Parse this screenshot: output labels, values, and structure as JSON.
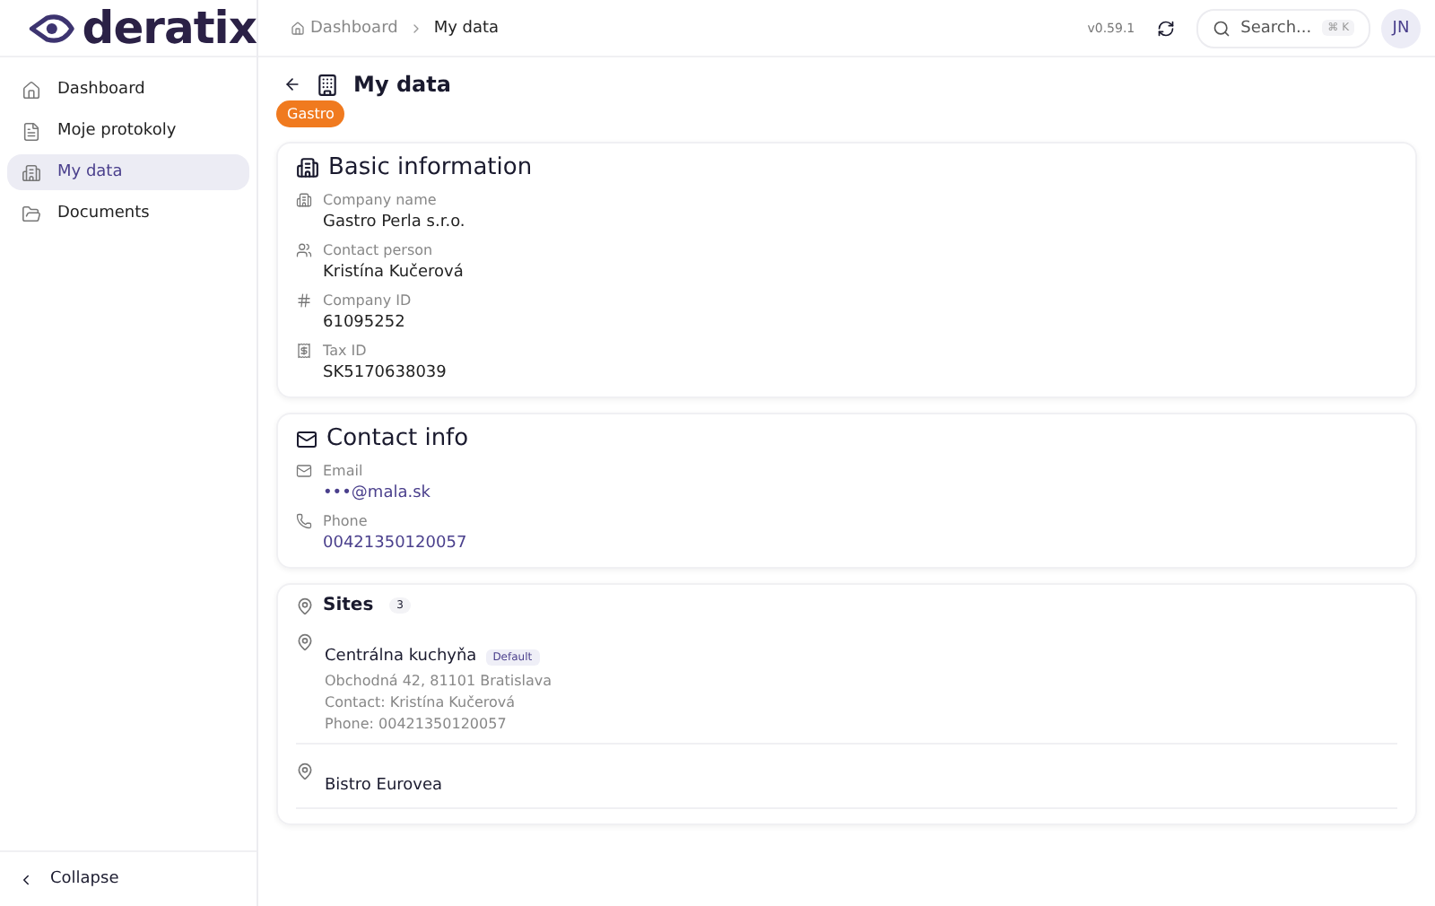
{
  "logo": {
    "text": "deratix"
  },
  "sidebar": {
    "items": [
      {
        "label": "Dashboard",
        "selected": false
      },
      {
        "label": "Moje protokoly",
        "selected": false
      },
      {
        "label": "My data",
        "selected": true
      },
      {
        "label": "Documents",
        "selected": false
      }
    ],
    "collapse": "Collapse"
  },
  "header": {
    "breadcrumbs": [
      "Dashboard",
      "My data"
    ],
    "version": "v0.59.1",
    "search": {
      "placeholder": "Search...",
      "shortcut": "⌘ K"
    },
    "avatar": "JN"
  },
  "page": {
    "title": "My data",
    "tag": "Gastro"
  },
  "basic_information": {
    "title": "Basic information",
    "fields": [
      {
        "label": "Company name",
        "value": "Gastro Perla s.r.o."
      },
      {
        "label": "Contact person",
        "value": "Kristína Kučerová"
      },
      {
        "label": "Company ID",
        "value": "61095252"
      },
      {
        "label": "Tax ID",
        "value": "SK5170638039"
      }
    ]
  },
  "contact_info": {
    "title": "Contact info",
    "fields": [
      {
        "label": "Email",
        "value": "•••@mala.sk"
      },
      {
        "label": "Phone",
        "value": "00421350120057"
      }
    ]
  },
  "sites": {
    "title": "Sites",
    "count": "3",
    "items": [
      {
        "name": "Centrálna kuchyňa",
        "badge": "Default",
        "address": "Obchodná 42, 81101 Bratislava",
        "contact": "Contact: Kristína Kučerová",
        "phone": "Phone: 00421350120057"
      },
      {
        "name": "Bistro Eurovea"
      }
    ]
  }
}
